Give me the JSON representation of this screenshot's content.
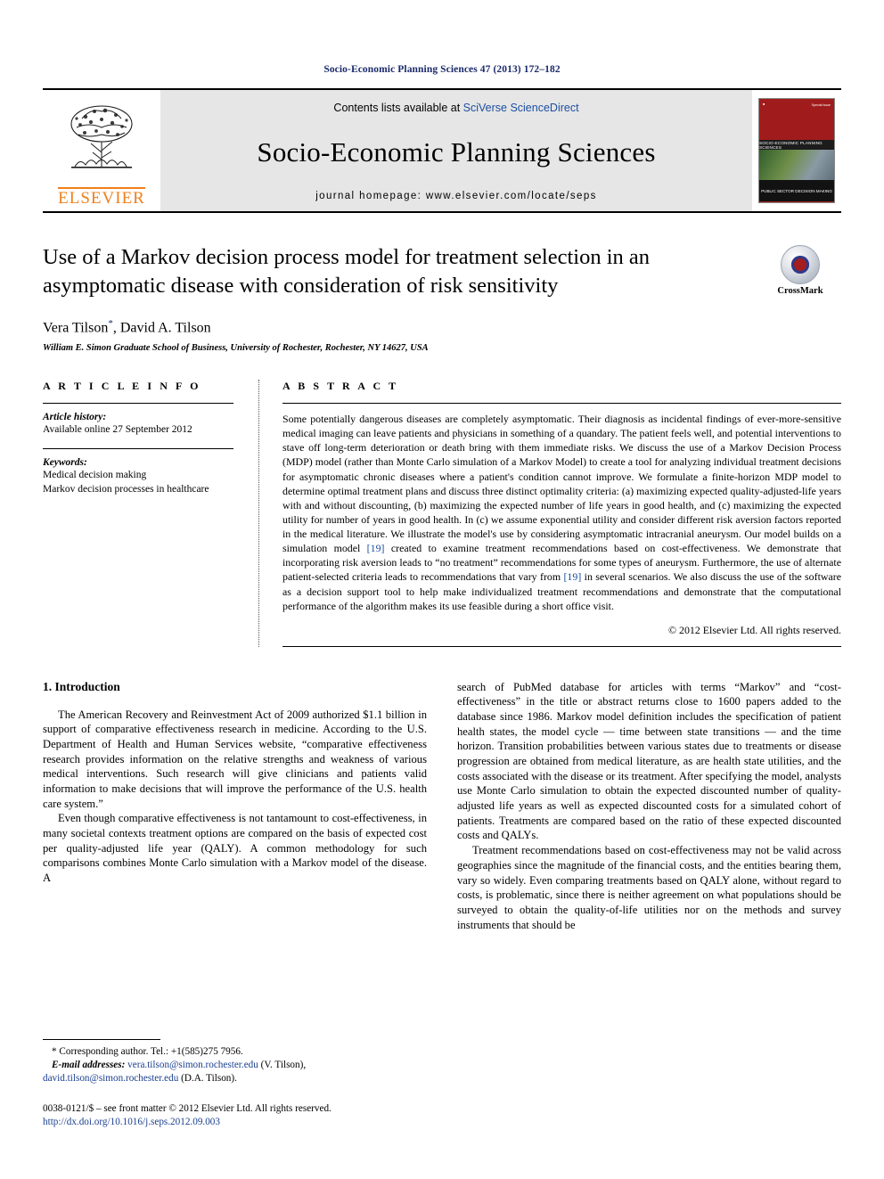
{
  "running_head": "Socio-Economic Planning Sciences 47 (2013) 172–182",
  "masthead": {
    "publisher_name": "ELSEVIER",
    "contents_prefix": "Contents lists available at ",
    "contents_link": "SciVerse ScienceDirect",
    "journal_title": "Socio-Economic Planning Sciences",
    "homepage": "journal homepage: www.elsevier.com/locate/seps",
    "cover": {
      "journal_name": "SOCIO-ECONOMIC PLANNING SCIENCES",
      "special_issue_label": "Special Issue",
      "subtitle": "PUBLIC SECTOR DECISION MAKING"
    }
  },
  "article": {
    "title": "Use of a Markov decision process model for treatment selection in an asymptomatic disease with consideration of risk sensitivity",
    "authors": "Vera Tilson",
    "corresponding_marker": "*",
    "authors_rest": ", David A. Tilson",
    "affiliation": "William E. Simon Graduate School of Business, University of Rochester, Rochester, NY 14627, USA",
    "crossmark_label": "CrossMark"
  },
  "article_info": {
    "heading": "A R T I C L E  I N F O",
    "history_label": "Article history:",
    "history_value": "Available online 27 September 2012",
    "keywords_label": "Keywords:",
    "keywords": [
      "Medical decision making",
      "Markov decision processes in healthcare"
    ]
  },
  "abstract": {
    "heading": "A B S T R A C T",
    "part1": "Some potentially dangerous diseases are completely asymptomatic. Their diagnosis as incidental findings of ever-more-sensitive medical imaging can leave patients and physicians in something of a quandary. The patient feels well, and potential interventions to stave off long-term deterioration or death bring with them immediate risks. We discuss the use of a Markov Decision Process (MDP) model (rather than Monte Carlo simulation of a Markov Model) to create a tool for analyzing individual treatment decisions for asymptomatic chronic diseases where a patient's condition cannot improve. We formulate a finite-horizon MDP model to determine optimal treatment plans and discuss three distinct optimality criteria: (a) maximizing expected quality-adjusted-life years with and without discounting, (b) maximizing the expected number of life years in good health, and (c) maximizing the expected utility for number of years in good health. In (c) we assume exponential utility and consider different risk aversion factors reported in the medical literature. We illustrate the model's use by considering asymptomatic intracranial aneurysm. Our model builds on a simulation model ",
    "ref1": "[19]",
    "part2": " created to examine treatment recommendations based on cost-effectiveness. We demonstrate that incorporating risk aversion leads to “no treatment” recommendations for some types of aneurysm. Furthermore, the use of alternate patient-selected criteria leads to recommendations that vary from ",
    "ref2": "[19]",
    "part3": " in several scenarios. We also discuss the use of the software as a decision support tool to help make individualized treatment recommendations and demonstrate that the computational performance of the algorithm makes its use feasible during a short office visit.",
    "copyright": "© 2012 Elsevier Ltd. All rights reserved."
  },
  "body": {
    "section_title": "1. Introduction",
    "left_paragraphs": [
      "The American Recovery and Reinvestment Act of 2009 authorized $1.1 billion in support of comparative effectiveness research in medicine. According to the U.S. Department of Health and Human Services website, “comparative effectiveness research provides information on the relative strengths and weakness of various medical interventions. Such research will give clinicians and patients valid information to make decisions that will improve the performance of the U.S. health care system.”",
      "Even though comparative effectiveness is not tantamount to cost-effectiveness, in many societal contexts treatment options are compared on the basis of expected cost per quality-adjusted life year (QALY). A common methodology for such comparisons combines Monte Carlo simulation with a Markov model of the disease. A"
    ],
    "right_paragraphs": [
      "search of PubMed database for articles with terms “Markov” and “cost-effectiveness” in the title or abstract returns close to 1600 papers added to the database since 1986. Markov model definition includes the specification of patient health states, the model cycle — time between state transitions — and the time horizon. Transition probabilities between various states due to treatments or disease progression are obtained from medical literature, as are health state utilities, and the costs associated with the disease or its treatment. After specifying the model, analysts use Monte Carlo simulation to obtain the expected discounted number of quality-adjusted life years as well as expected discounted costs for a simulated cohort of patients. Treatments are compared based on the ratio of these expected discounted costs and QALYs.",
      "Treatment recommendations based on cost-effectiveness may not be valid across geographies since the magnitude of the financial costs, and the entities bearing them, vary so widely. Even comparing treatments based on QALY alone, without regard to costs, is problematic, since there is neither agreement on what populations should be surveyed to obtain the quality-of-life utilities nor on the methods and survey instruments that should be"
    ]
  },
  "footnotes": {
    "corresponding": "* Corresponding author. Tel.: +1(585)275 7956.",
    "email_label": "E-mail addresses:",
    "email1": "vera.tilson@simon.rochester.edu",
    "email1_owner": " (V. Tilson), ",
    "email2": "david.tilson@simon.rochester.edu",
    "email2_owner": " (D.A. Tilson).",
    "issn_line": "0038-0121/$ – see front matter © 2012 Elsevier Ltd. All rights reserved.",
    "doi": "http://dx.doi.org/10.1016/j.seps.2012.09.003"
  },
  "colors": {
    "link": "#1c4fa1",
    "running_head": "#1b2a6b",
    "elsevier_orange": "#f07f1a",
    "masthead_bg": "#e6e6e6"
  }
}
